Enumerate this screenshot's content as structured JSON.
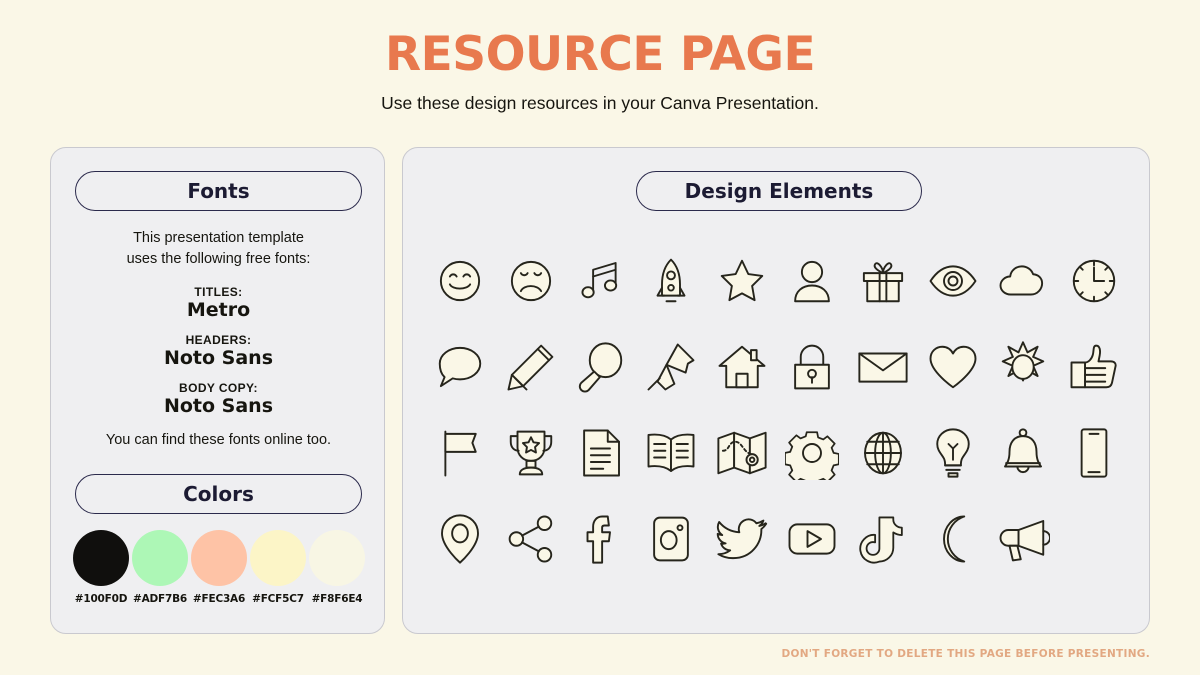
{
  "header": {
    "title": "RESOURCE PAGE",
    "subtitle": "Use these design resources in your Canva Presentation.",
    "title_color": "#E8794E"
  },
  "fonts_panel": {
    "pill_label": "Fonts",
    "intro_line1": "This presentation template",
    "intro_line2": "uses the following free fonts:",
    "groups": [
      {
        "label": "TITLES:",
        "value": "Metro"
      },
      {
        "label": "HEADERS:",
        "value": "Noto Sans"
      },
      {
        "label": "BODY COPY:",
        "value": "Noto Sans"
      }
    ],
    "online_note": "You can find these fonts online too."
  },
  "colors_panel": {
    "pill_label": "Colors",
    "swatches": [
      {
        "hex": "#100F0D"
      },
      {
        "hex": "#ADF7B6"
      },
      {
        "hex": "#FEC3A6"
      },
      {
        "hex": "#FCF5C7"
      },
      {
        "hex": "#F8F6E4"
      }
    ]
  },
  "design_panel": {
    "pill_label": "Design Elements",
    "icons": [
      "smiley-face-icon",
      "sad-face-icon",
      "music-note-icon",
      "rocket-icon",
      "star-icon",
      "person-icon",
      "gift-icon",
      "eye-icon",
      "cloud-icon",
      "clock-icon",
      "speech-bubble-icon",
      "pencil-icon",
      "magnifying-glass-icon",
      "pushpin-icon",
      "house-icon",
      "lock-icon",
      "envelope-icon",
      "heart-icon",
      "sun-icon",
      "thumbs-up-icon",
      "flag-icon",
      "trophy-icon",
      "document-icon",
      "book-icon",
      "map-icon",
      "gear-icon",
      "globe-icon",
      "lightbulb-icon",
      "bell-icon",
      "phone-icon",
      "location-pin-icon",
      "share-icon",
      "facebook-icon",
      "instagram-icon",
      "twitter-icon",
      "youtube-icon",
      "tiktok-icon",
      "moon-icon",
      "megaphone-icon"
    ]
  },
  "footer": {
    "note": "DON'T FORGET TO DELETE THIS PAGE BEFORE PRESENTING.",
    "color": "#E2A882"
  }
}
